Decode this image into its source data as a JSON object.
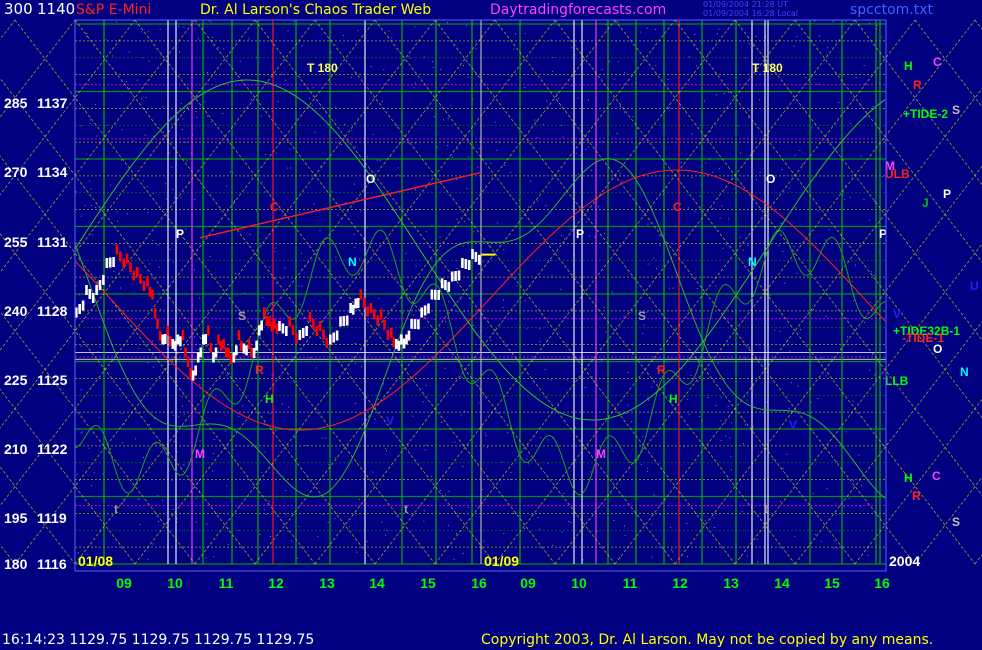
{
  "header": {
    "instrument": "S&P E-Mini",
    "title": "Dr. Al Larson's Chaos Trader Web",
    "site": "Daytradingforecasts.com",
    "stamp_line1": "01/09/2004 21:28 UT",
    "stamp_line2": "01/09/2004 16:28 Local",
    "file": "spcctom.txt"
  },
  "footer": {
    "quote": "16:14:23  1129.75  1129.75  1129.75  1129.75",
    "copyright": "Copyright 2003, Dr. Al Larson. May not be copied by any means."
  },
  "colors": {
    "background": "#000080",
    "price_up": "#ffffff",
    "price_down": "#ff0000",
    "grid_green": "#00c000",
    "grid_yellow": "#e0e000",
    "grid_magenta": "#ff00ff",
    "tide_green": "#30b030",
    "tide_red": "#ff2020",
    "title_color": "#ffff00",
    "site_color": "#ff40ff",
    "instrument_color": "#ff2020",
    "file_color": "#4040ff"
  },
  "chart_data": {
    "type": "line",
    "instrument": "S&P E-Mini",
    "x_date_labels": [
      "01/08",
      "01/09"
    ],
    "x_ticks": [
      "09",
      "10",
      "11",
      "12",
      "13",
      "14",
      "15",
      "16",
      "09",
      "10",
      "11",
      "12",
      "13",
      "14",
      "15",
      "16"
    ],
    "year_label": "2004",
    "y_left_ticks": [
      "300",
      "285",
      "270",
      "255",
      "240",
      "225",
      "210",
      "195",
      "180"
    ],
    "y_right_ticks": [
      "1140",
      "1137",
      "1134",
      "1131",
      "1128",
      "1125",
      "1122",
      "1119",
      "1116"
    ],
    "ylim": [
      1116,
      1140
    ],
    "price_series": {
      "name": "",
      "x_hours": [
        8.0,
        8.2,
        8.4,
        8.6,
        8.8,
        9.0,
        9.2,
        9.4,
        9.5,
        9.6,
        9.7,
        9.8,
        9.9,
        10.0,
        10.1,
        10.2,
        10.3,
        10.4,
        10.5,
        10.6,
        10.7,
        10.8,
        10.9,
        11.0,
        11.1,
        11.2,
        11.3,
        11.4,
        11.5,
        11.6,
        11.7,
        11.8,
        11.9,
        12.0,
        12.2,
        12.4,
        12.6,
        12.8,
        13.0,
        13.2,
        13.4,
        13.5,
        13.6,
        13.8,
        14.0,
        14.2,
        14.3,
        14.4,
        14.5,
        14.6,
        14.8,
        15.0,
        15.2,
        15.4,
        15.6,
        15.8,
        16.0
      ],
      "y": [
        1127.0,
        1128.0,
        1128.0,
        1129.2,
        1129.8,
        1129.4,
        1128.8,
        1128.4,
        1127.8,
        1126.5,
        1125.8,
        1126.2,
        1125.6,
        1125.8,
        1126.0,
        1124.8,
        1124.2,
        1125.0,
        1125.8,
        1126.2,
        1125.0,
        1125.8,
        1125.6,
        1125.2,
        1125.0,
        1126.0,
        1125.4,
        1125.6,
        1125.2,
        1126.2,
        1127.0,
        1126.6,
        1126.5,
        1126.4,
        1126.6,
        1126.0,
        1126.8,
        1126.4,
        1125.8,
        1126.6,
        1127.2,
        1127.4,
        1127.8,
        1127.2,
        1126.9,
        1126.1,
        1125.6,
        1125.8,
        1125.8,
        1126.5,
        1127.0,
        1127.8,
        1128.3,
        1128.6,
        1129.2,
        1129.6,
        1129.75
      ]
    },
    "markers": [
      {
        "label": "T 180",
        "color": "#ffff60"
      },
      {
        "label": "T 180",
        "color": "#ffff60"
      },
      {
        "label": "P",
        "color": "#ffffff"
      },
      {
        "label": "P",
        "color": "#ffffff"
      },
      {
        "label": "P",
        "color": "#ffffff"
      },
      {
        "label": "O",
        "color": "#ffffff"
      },
      {
        "label": "O",
        "color": "#ffffff"
      },
      {
        "label": "C",
        "color": "#ff2020"
      },
      {
        "label": "C",
        "color": "#ff2020"
      },
      {
        "label": "N",
        "color": "#00ffff"
      },
      {
        "label": "N",
        "color": "#00ffff"
      },
      {
        "label": "S",
        "color": "#a0a0a0"
      },
      {
        "label": "S",
        "color": "#a0a0a0"
      },
      {
        "label": "H",
        "color": "#00ff00"
      },
      {
        "label": "H",
        "color": "#00ff00"
      },
      {
        "label": "M",
        "color": "#ff40ff"
      },
      {
        "label": "M",
        "color": "#ff40ff"
      },
      {
        "label": "R",
        "color": "#ff2020"
      },
      {
        "label": "R",
        "color": "#ff2020"
      },
      {
        "label": "V",
        "color": "#2020ff"
      },
      {
        "label": "V",
        "color": "#2020ff"
      },
      {
        "label": "t",
        "color": "#a0a0a0"
      },
      {
        "label": "t",
        "color": "#a0a0a0"
      },
      {
        "label": "t",
        "color": "#a0a0a0"
      }
    ],
    "legend": [
      {
        "label": "H",
        "color": "#00ff00"
      },
      {
        "label": "C",
        "color": "#ff40ff"
      },
      {
        "label": "R",
        "color": "#ff2020"
      },
      {
        "label": "+TIDE-2",
        "color": "#00ff00"
      },
      {
        "label": "S",
        "color": "#c0c0c0"
      },
      {
        "label": "M",
        "color": "#ff40ff"
      },
      {
        "label": "ULB",
        "color": "#ff2020"
      },
      {
        "label": "P",
        "color": "#ffffff"
      },
      {
        "label": "J",
        "color": "#00c000"
      },
      {
        "label": "U",
        "color": "#2020ff"
      },
      {
        "label": "V",
        "color": "#2020ff"
      },
      {
        "label": "+TIDE32B-1",
        "color": "#00ff00"
      },
      {
        "label": "-TIDE-1",
        "color": "#ff2020"
      },
      {
        "label": "O",
        "color": "#ffffff"
      },
      {
        "label": "N",
        "color": "#00ffff"
      },
      {
        "label": "LLB",
        "color": "#00ff00"
      },
      {
        "label": "H",
        "color": "#00ff00"
      },
      {
        "label": "C",
        "color": "#ff40ff"
      },
      {
        "label": "R",
        "color": "#ff2020"
      },
      {
        "label": "S",
        "color": "#c0c0c0"
      }
    ],
    "grid": true
  }
}
